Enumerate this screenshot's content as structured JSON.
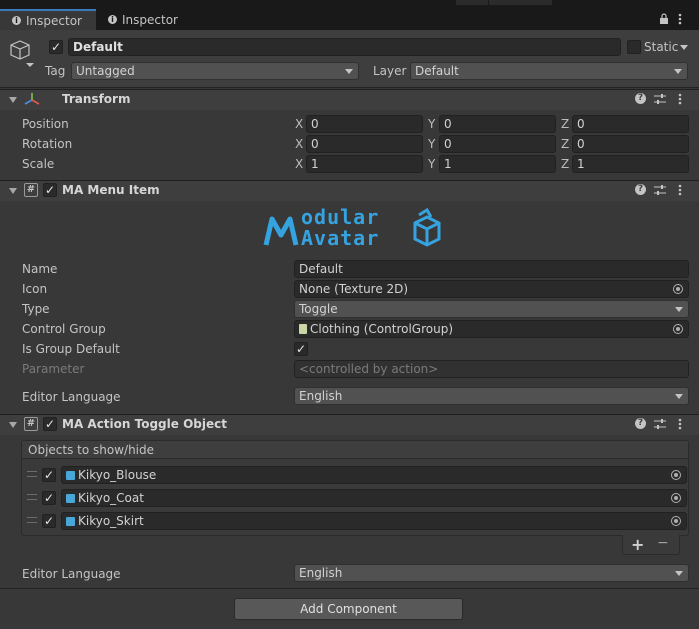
{
  "tabs": [
    {
      "label": "Inspector",
      "icon": "info-icon"
    },
    {
      "label": "Inspector"
    }
  ],
  "object": {
    "name": "Default",
    "static_label": "Static",
    "tag_label": "Tag",
    "tag_value": "Untagged",
    "layer_label": "Layer",
    "layer_value": "Default"
  },
  "transform": {
    "title": "Transform",
    "rows": [
      {
        "label": "Position",
        "x": "0",
        "y": "0",
        "z": "0"
      },
      {
        "label": "Rotation",
        "x": "0",
        "y": "0",
        "z": "0"
      },
      {
        "label": "Scale",
        "x": "1",
        "y": "1",
        "z": "1"
      }
    ],
    "axes": [
      "X",
      "Y",
      "Z"
    ]
  },
  "menu_item": {
    "title": "MA Menu Item",
    "logo_line1": "odular",
    "logo_line2": "Avatar",
    "logo_letter": "M",
    "fields": {
      "name_label": "Name",
      "name_value": "Default",
      "icon_label": "Icon",
      "icon_value": "None (Texture 2D)",
      "type_label": "Type",
      "type_value": "Toggle",
      "control_group_label": "Control Group",
      "control_group_value": "Clothing (ControlGroup)",
      "is_group_default_label": "Is Group Default",
      "parameter_label": "Parameter",
      "parameter_value": "<controlled by action>",
      "editor_language_label": "Editor Language",
      "editor_language_value": "English"
    }
  },
  "toggle_object": {
    "title": "MA Action Toggle Object",
    "list_header": "Objects to show/hide",
    "items": [
      {
        "name": "Kikyo_Blouse"
      },
      {
        "name": "Kikyo_Coat"
      },
      {
        "name": "Kikyo_Skirt"
      }
    ],
    "plus": "+",
    "minus": "−",
    "editor_language_label": "Editor Language",
    "editor_language_value": "English"
  },
  "add_component_label": "Add Component",
  "colors": {
    "accent": "#3a79bb",
    "logo": "#35a3e0",
    "panel": "#383838"
  }
}
